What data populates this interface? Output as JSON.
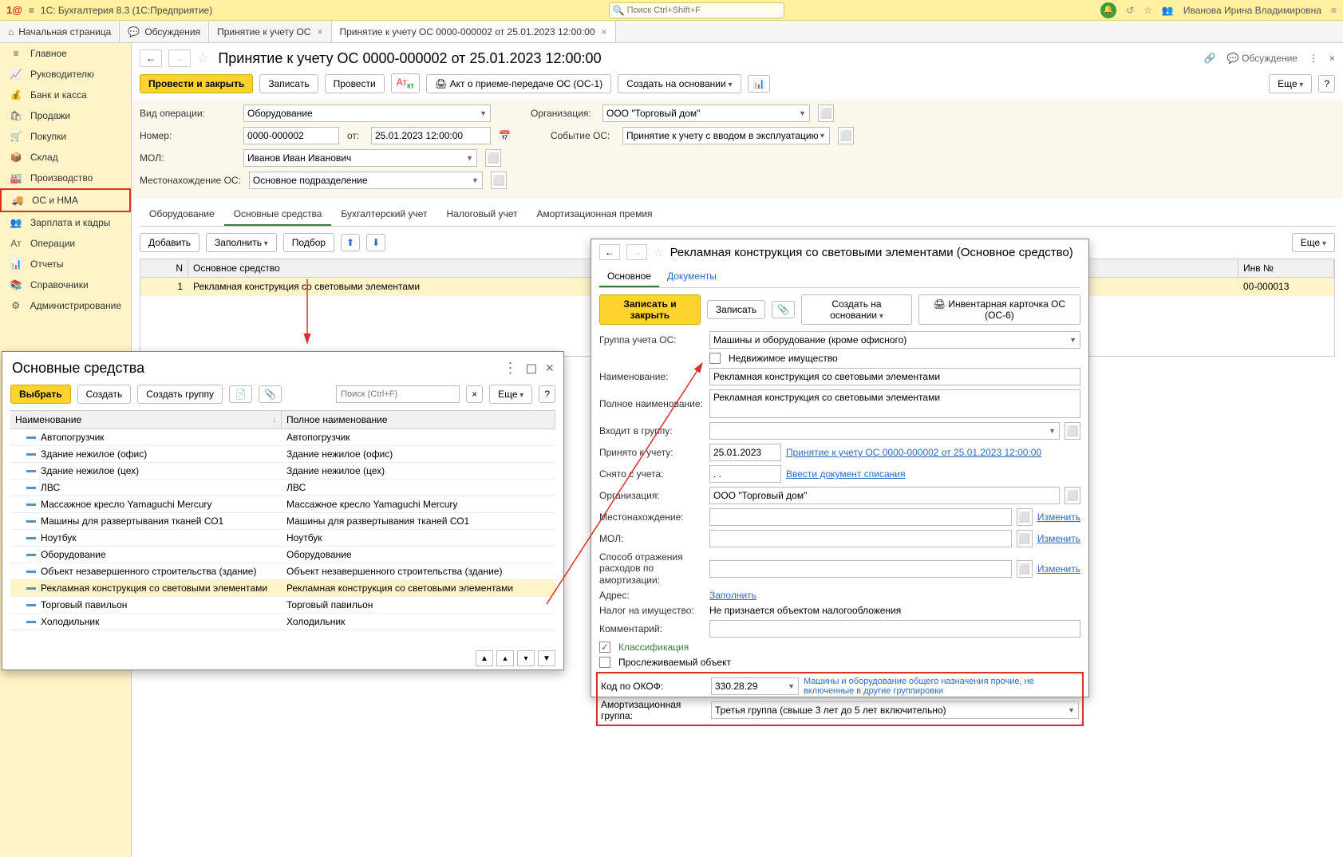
{
  "topbar": {
    "title": "1С: Бухгалтерия 8.3  (1С:Предприятие)",
    "search_placeholder": "Поиск Ctrl+Shift+F",
    "user": "Иванова Ирина Владимировна"
  },
  "tabs": [
    {
      "label": "Начальная страница"
    },
    {
      "label": "Обсуждения"
    },
    {
      "label": "Принятие к учету ОС"
    },
    {
      "label": "Принятие к учету ОС 0000-000002 от 25.01.2023 12:00:00"
    }
  ],
  "sidebar": [
    "Главное",
    "Руководителю",
    "Банк и касса",
    "Продажи",
    "Покупки",
    "Склад",
    "Производство",
    "ОС и НМА",
    "Зарплата и кадры",
    "Операции",
    "Отчеты",
    "Справочники",
    "Администрирование"
  ],
  "doc": {
    "title": "Принятие к учету ОС 0000-000002 от 25.01.2023 12:00:00",
    "discuss": "Обсуждение",
    "btn_primary": "Провести и закрыть",
    "btn_save": "Записать",
    "btn_post": "Провести",
    "btn_act": "Акт о приеме-передаче ОС (ОС-1)",
    "btn_create_based": "Создать на основании",
    "btn_more": "Еще",
    "form": {
      "vid_label": "Вид операции:",
      "vid_value": "Оборудование",
      "org_label": "Организация:",
      "org_value": "ООО \"Торговый дом\"",
      "num_label": "Номер:",
      "num_value": "0000-000002",
      "ot_label": "от:",
      "date_value": "25.01.2023 12:00:00",
      "event_label": "Событие ОС:",
      "event_value": "Принятие к учету с вводом в эксплуатацию",
      "mol_label": "МОЛ:",
      "mol_value": "Иванов Иван Иванович",
      "location_label": "Местонахождение ОС:",
      "location_value": "Основное подразделение"
    },
    "inner_tabs": [
      "Оборудование",
      "Основные средства",
      "Бухгалтерский учет",
      "Налоговый учет",
      "Амортизационная премия"
    ],
    "btn_add": "Добавить",
    "btn_fill": "Заполнить",
    "btn_pick": "Подбор",
    "table": {
      "col_n": "N",
      "col_name": "Основное средство",
      "col_inv": "Инв №",
      "rows": [
        {
          "n": "1",
          "name": "Рекламная конструкция со световыми элементами",
          "inv": "00-000013"
        }
      ]
    }
  },
  "dialog": {
    "title": "Основные средства",
    "btn_select": "Выбрать",
    "btn_create": "Создать",
    "btn_group": "Создать группу",
    "search_placeholder": "Поиск (Ctrl+F)",
    "btn_more": "Еще",
    "col1": "Наименование",
    "col2": "Полное наименование",
    "items": [
      {
        "name": "Автопогрузчик",
        "full": "Автопогрузчик"
      },
      {
        "name": "Здание нежилое (офис)",
        "full": "Здание нежилое (офис)"
      },
      {
        "name": "Здание нежилое (цех)",
        "full": "Здание нежилое (цех)"
      },
      {
        "name": "ЛВС",
        "full": "ЛВС"
      },
      {
        "name": "Массажное кресло Yamaguchi Mercury",
        "full": "Массажное кресло Yamaguchi Mercury"
      },
      {
        "name": "Машины для развертывания тканей СО1",
        "full": "Машины для развертывания тканей СО1"
      },
      {
        "name": "Ноутбук",
        "full": "Ноутбук"
      },
      {
        "name": "Оборудование",
        "full": "Оборудование"
      },
      {
        "name": "Объект незавершенного строительства (здание)",
        "full": "Объект незавершенного строительства (здание)"
      },
      {
        "name": "Рекламная конструкция со световыми элементами",
        "full": "Рекламная конструкция со световыми элементами",
        "selected": true
      },
      {
        "name": "Торговый павильон",
        "full": "Торговый павильон"
      },
      {
        "name": "Холодильник",
        "full": "Холодильник"
      }
    ]
  },
  "card": {
    "title": "Рекламная конструкция со световыми элементами (Основное средство)",
    "tabs": [
      "Основное",
      "Документы"
    ],
    "btn_primary": "Записать и закрыть",
    "btn_save": "Записать",
    "btn_create_based": "Создать на основании",
    "btn_inv_card": "Инвентарная карточка ОС (ОС-6)",
    "group_label": "Группа учета ОС:",
    "group_value": "Машины и оборудование (кроме офисного)",
    "realestate": "Недвижимое имущество",
    "name_label": "Наименование:",
    "name_value": "Рекламная конструкция со световыми элементами",
    "fullname_label": "Полное наименование:",
    "fullname_value": "Рекламная конструкция со световыми элементами",
    "in_group_label": "Входит в группу:",
    "accepted_label": "Принято к учету:",
    "accepted_date": "25.01.2023",
    "accepted_link": "Принятие к учету ОС 0000-000002 от 25.01.2023 12:00:00",
    "removed_label": "Снято с учета:",
    "removed_date": ".  .",
    "writeoff_link": "Ввести документ списания",
    "org_label": "Организация:",
    "org_value": "ООО \"Торговый дом\"",
    "location_label": "Местонахождение:",
    "change_link": "Изменить",
    "mol_label": "МОЛ:",
    "amort_label": "Способ отражения расходов по амортизации:",
    "address_label": "Адрес:",
    "fill_link": "Заполнить",
    "tax_label": "Налог на имущество:",
    "tax_value": "Не признается объектом налогообложения",
    "comment_label": "Комментарий:",
    "classification": "Классификация",
    "trackable": "Прослеживаемый объект",
    "okof_label": "Код по ОКОФ:",
    "okof_value": "330.28.29",
    "okof_desc": "Машины и оборудование общего назначения прочие, не включенные в другие группировки",
    "amort_group_label": "Амортизационная группа:",
    "amort_group_value": "Третья группа (свыше 3 лет до 5 лет включительно)"
  }
}
